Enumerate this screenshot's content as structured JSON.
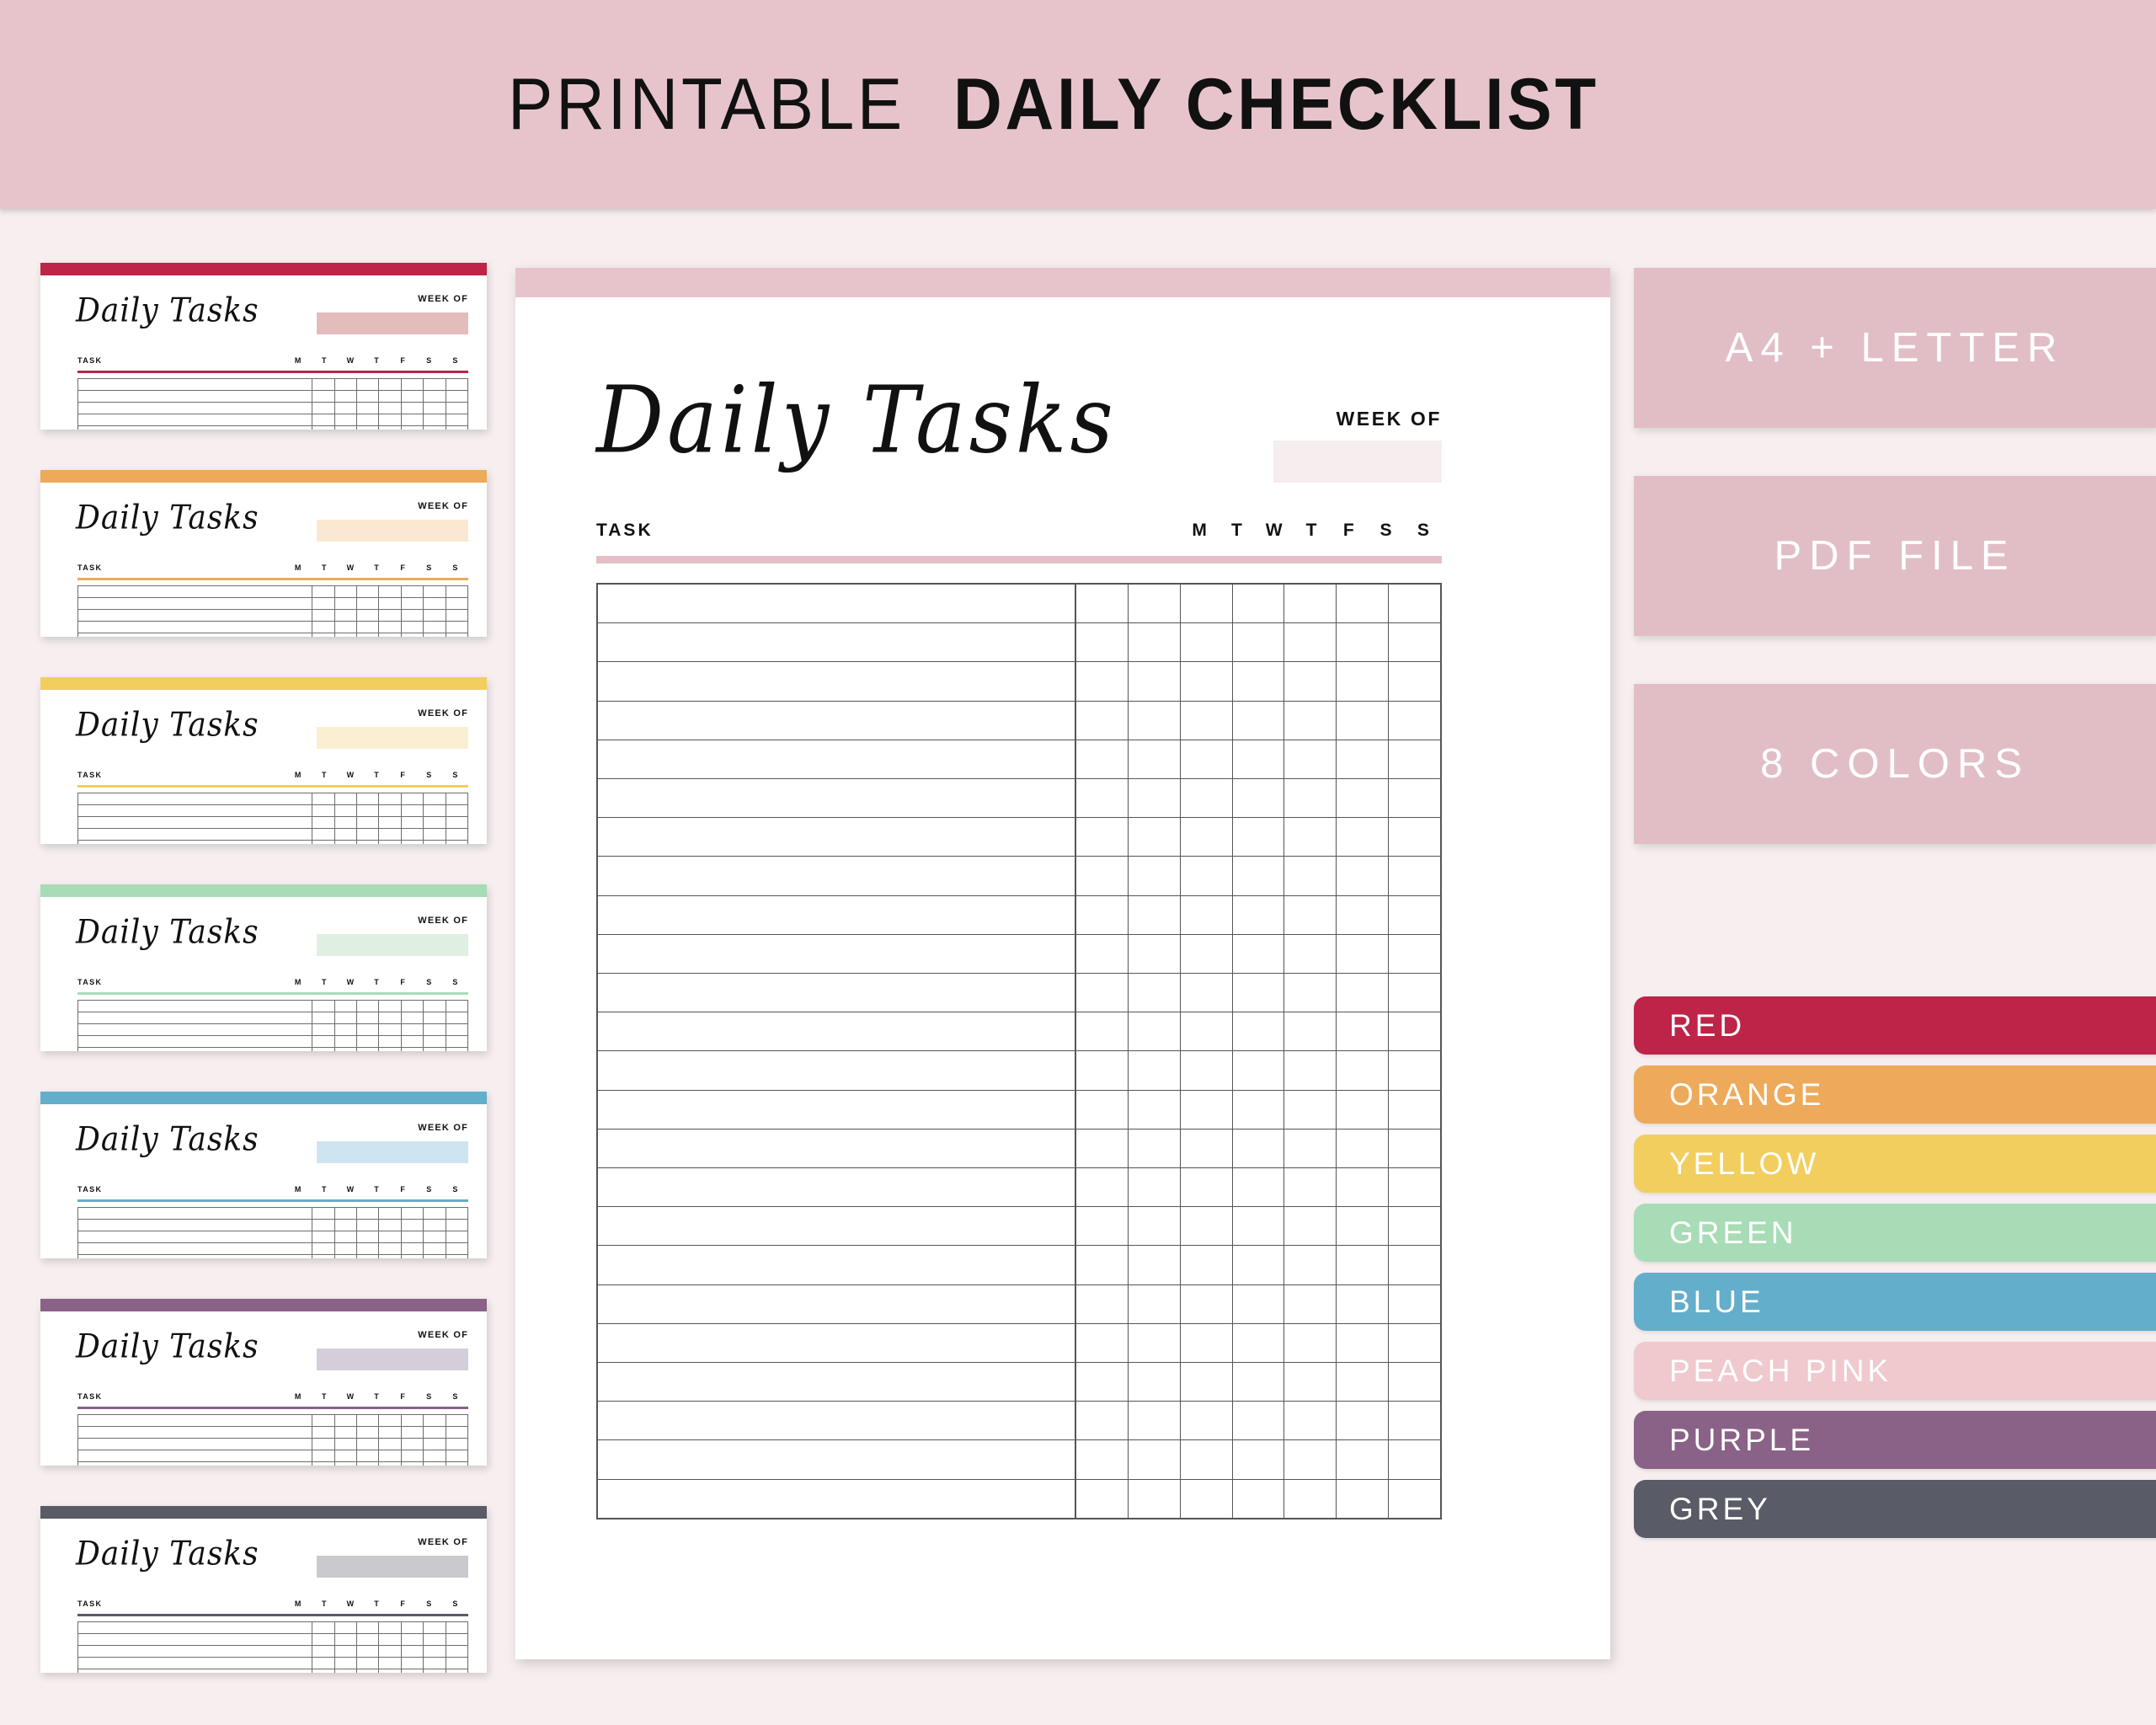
{
  "banner": {
    "title_light": "PRINTABLE",
    "title_bold": "DAILY CHECKLIST",
    "background": "#E7C4CC"
  },
  "page": {
    "background": "#F7EFEF"
  },
  "sheet": {
    "title": "Daily Tasks",
    "week_of_label": "WEEK OF",
    "task_header": "TASK",
    "days": [
      "M",
      "T",
      "W",
      "T",
      "F",
      "S",
      "S"
    ],
    "accent_color": "#E7C4CC",
    "rule_color": "#E3BFC6",
    "week_box_color": "#F6EDEE",
    "row_count": 24
  },
  "thumbnails": [
    {
      "title": "Daily Tasks",
      "week_of_label": "WEEK OF",
      "task_header": "TASK",
      "color_name": "RED",
      "bar_color": "#BE2448",
      "rule_color": "#BE2448",
      "week_box_color": "#E3BCBC"
    },
    {
      "title": "Daily Tasks",
      "week_of_label": "WEEK OF",
      "task_header": "TASK",
      "color_name": "ORANGE",
      "bar_color": "#EDAA5B",
      "rule_color": "#EDAA5B",
      "week_box_color": "#FAE8D2"
    },
    {
      "title": "Daily Tasks",
      "week_of_label": "WEEK OF",
      "task_header": "TASK",
      "color_name": "YELLOW",
      "bar_color": "#F2CE5E",
      "rule_color": "#F2CE5E",
      "week_box_color": "#FBEFD1"
    },
    {
      "title": "Daily Tasks",
      "week_of_label": "WEEK OF",
      "task_header": "TASK",
      "color_name": "GREEN",
      "bar_color": "#A8DCB6",
      "rule_color": "#A8DCB6",
      "week_box_color": "#DFF0E2"
    },
    {
      "title": "Daily Tasks",
      "week_of_label": "WEEK OF",
      "task_header": "TASK",
      "color_name": "BLUE",
      "bar_color": "#63AECB",
      "rule_color": "#63AECB",
      "week_box_color": "#CFE4F1"
    },
    {
      "title": "Daily Tasks",
      "week_of_label": "WEEK OF",
      "task_header": "TASK",
      "color_name": "PURPLE",
      "bar_color": "#8A6287",
      "rule_color": "#8A6287",
      "week_box_color": "#D5CEDA"
    },
    {
      "title": "Daily Tasks",
      "week_of_label": "WEEK OF",
      "task_header": "TASK",
      "color_name": "GREY",
      "bar_color": "#595B66",
      "rule_color": "#595B66",
      "week_box_color": "#C9C9CE"
    }
  ],
  "badges": [
    {
      "label": "A4 + LETTER",
      "color": "#E1BEC6"
    },
    {
      "label": "PDF FILE",
      "color": "#E1BEC6"
    },
    {
      "label": "8 COLORS",
      "color": "#E1BEC6"
    }
  ],
  "swatches": [
    {
      "label": "RED",
      "color": "#BE2448"
    },
    {
      "label": "ORANGE",
      "color": "#EDAA5B"
    },
    {
      "label": "YELLOW",
      "color": "#F2CE5E"
    },
    {
      "label": "GREEN",
      "color": "#A8DCB6"
    },
    {
      "label": "BLUE",
      "color": "#63AECB"
    },
    {
      "label": "PEACH PINK",
      "color": "#EFC9CE"
    },
    {
      "label": "PURPLE",
      "color": "#8A6287"
    },
    {
      "label": "GREY",
      "color": "#595B66"
    }
  ]
}
